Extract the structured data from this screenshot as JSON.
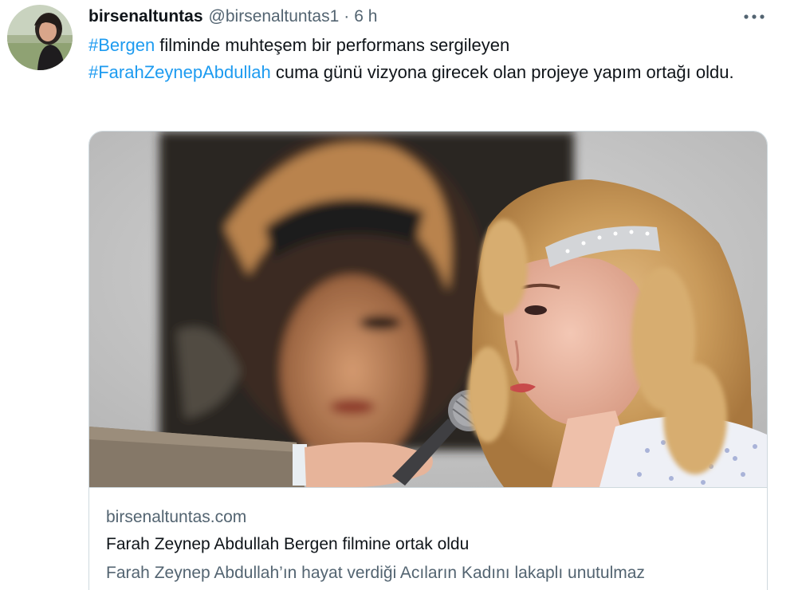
{
  "tweet": {
    "display_name": "birsenaltuntas",
    "handle": "@birsenaltuntas1",
    "separator": "·",
    "time": "6 h",
    "more_icon": "more-horizontal-icon",
    "text": {
      "hashtag1": "#Bergen",
      "part1": " filminde muhteşem bir performans sergileyen",
      "hashtag2": "#FarahZeynepAbdullah",
      "part2": " cuma günü vizyona girecek olan projeye yapım ortağı oldu."
    }
  },
  "card": {
    "domain": "birsenaltuntas.com",
    "title": "Farah Zeynep Abdullah Bergen filmine ortak oldu",
    "description": "Farah Zeynep Abdullah’ın hayat verdiği Acıların Kadını lakaplı unutulmaz"
  },
  "colors": {
    "link": "#1d9bf0",
    "text": "#0f1419",
    "secondary": "#536471",
    "border": "#cfd9de"
  }
}
